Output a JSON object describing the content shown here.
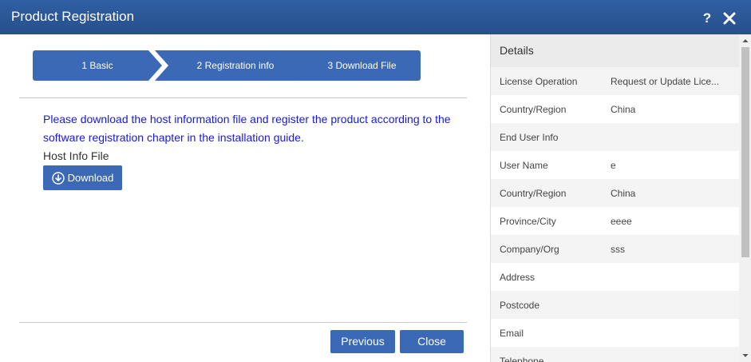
{
  "window": {
    "title": "Product Registration",
    "help_label": "?",
    "close_icon": "close-icon"
  },
  "wizard": {
    "steps": [
      {
        "label": "1 Basic"
      },
      {
        "label": "2 Registration info"
      },
      {
        "label": "3 Download File"
      }
    ]
  },
  "content": {
    "message": "Please download the host information file and register the product according to the software registration chapter in the installation guide.",
    "host_info_label": "Host Info File",
    "download_label": "Download",
    "download_icon": "download-circle-icon"
  },
  "footer": {
    "previous_label": "Previous",
    "close_label": "Close"
  },
  "details": {
    "header": "Details",
    "rows": [
      {
        "key": "License Operation",
        "value": "Request or Update Lice..."
      },
      {
        "key": "Country/Region",
        "value": "China"
      },
      {
        "key": "End User Info",
        "value": ""
      },
      {
        "key": "User Name",
        "value": "e"
      },
      {
        "key": "Country/Region",
        "value": "China"
      },
      {
        "key": "Province/City",
        "value": "eeee"
      },
      {
        "key": "Company/Org",
        "value": "sss"
      },
      {
        "key": "Address",
        "value": ""
      },
      {
        "key": "Postcode",
        "value": ""
      },
      {
        "key": "Email",
        "value": ""
      },
      {
        "key": "Telephone",
        "value": ""
      }
    ]
  },
  "colors": {
    "titlebar": "#2b579a",
    "accent": "#3b69b5",
    "message_text": "#1a1ad6"
  }
}
